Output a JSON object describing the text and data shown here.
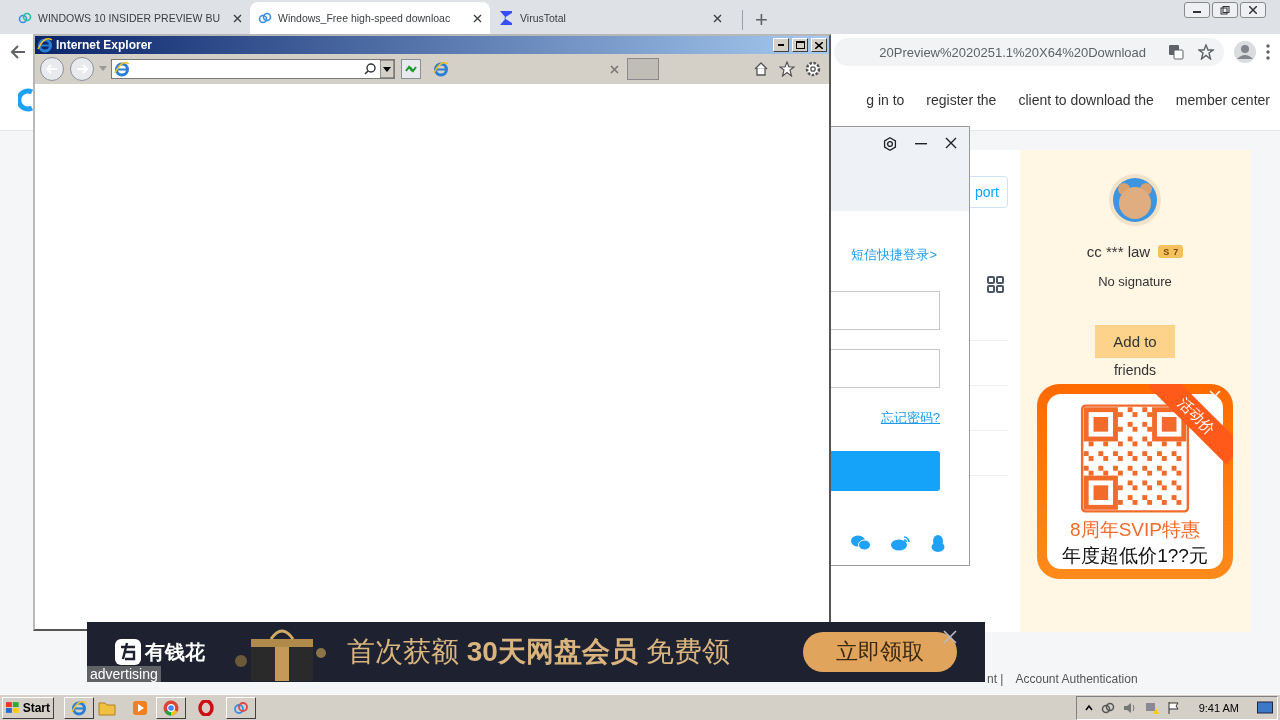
{
  "browser": {
    "tabs": [
      {
        "title": "WINDOWS 10 INSIDER PREVIEW BU",
        "selected": false
      },
      {
        "title": "Windows_Free high-speed downloac",
        "selected": true
      },
      {
        "title": "VirusTotal",
        "selected": false
      }
    ],
    "new_tab": "+",
    "address": "20Preview%2020251.1%20X64%20Download"
  },
  "site": {
    "nav": [
      "g in to",
      "register the",
      "client to download the",
      "member center"
    ],
    "support_button": "port",
    "profile": {
      "name": "cc *** law",
      "badge_letter": "S",
      "badge_level": "7",
      "signature": "No signature",
      "add_button": "Add to",
      "add_button_overflow": "friends"
    },
    "promo": {
      "ribbon": "活动价",
      "title": "8周年SVIP特惠",
      "subtitle": "年度超低价1??元"
    },
    "footer": [
      "nt |",
      "Account Authentication"
    ]
  },
  "login_dialog": {
    "sms_link": "短信快捷登录>",
    "forgot_link": "忘记密码?"
  },
  "ie_window": {
    "title": "Internet Explorer"
  },
  "ad": {
    "label": "advertising",
    "brand": "有钱花",
    "headline": "首次获额 **30天网盘会员** 免费领",
    "cta": "立即领取"
  },
  "taskbar": {
    "start": "Start",
    "clock": "9:41 AM"
  }
}
